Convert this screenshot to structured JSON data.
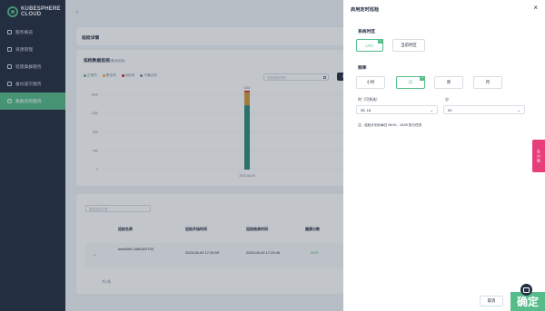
{
  "sidebar": {
    "logo": "KUBESPHERE CLOUD",
    "items": [
      {
        "label": "服务概览"
      },
      {
        "label": "资源管理"
      },
      {
        "label": "轻量集群服务"
      },
      {
        "label": "备份容灾服务"
      },
      {
        "label": "集群巡检服务"
      }
    ]
  },
  "main": {
    "back": "‹",
    "detail_title": "巡检详情",
    "chart": {
      "title": "巡检数据监视",
      "subtitle": "(最近巡检)",
      "legend": [
        {
          "label": "正常项",
          "color": "#55bc8a"
        },
        {
          "label": "警告项",
          "color": "#f5a623"
        },
        {
          "label": "危险项",
          "color": "#ca2621"
        },
        {
          "label": "不通过项",
          "color": "#79879c"
        }
      ],
      "date_placeholder": "选择巡检时间",
      "view_button": "查看"
    },
    "table": {
      "search_placeholder": "搜索巡检记录",
      "headers": [
        "巡检名称",
        "巡检开始时间",
        "巡检结束时间",
        "健康分数"
      ],
      "rows": [
        {
          "name": "test0609-1686302700",
          "start": "2023-06-09 17:25:03",
          "end": "2023-06-09 17:25:40",
          "score": "98分"
        }
      ],
      "total": "共1条"
    }
  },
  "chart_data": {
    "type": "bar",
    "categories": [
      "2023-06-09"
    ],
    "series": [
      {
        "name": "正常项",
        "values": [
          1370
        ],
        "color": "#2e8c7a"
      },
      {
        "name": "警告项",
        "values": [
          280
        ],
        "color": "#d29c3b"
      },
      {
        "name": "危险项",
        "values": [
          30
        ],
        "color": "#ca2621"
      }
    ],
    "bar_label": "1682",
    "yticks": [
      0,
      400,
      800,
      1200,
      1600
    ],
    "ylim": [
      0,
      1700
    ]
  },
  "drawer": {
    "title": "启用定时巡检",
    "timezone_label": "系统时区",
    "timezone_options": [
      "UTC",
      "当前时区"
    ],
    "timezone_selected": 0,
    "frequency_label": "频率",
    "frequency_options": [
      "小时",
      "日",
      "周",
      "月"
    ],
    "frequency_selected": 1,
    "hour_label": "时（可多选）",
    "hour_value": "08, 18",
    "minute_label": "分",
    "minute_value": "00",
    "note": "注：巡检计划为每日 08:00、18:00 执行任务",
    "cancel": "取消",
    "ok": "确定"
  },
  "float_tab": "社 小 助"
}
